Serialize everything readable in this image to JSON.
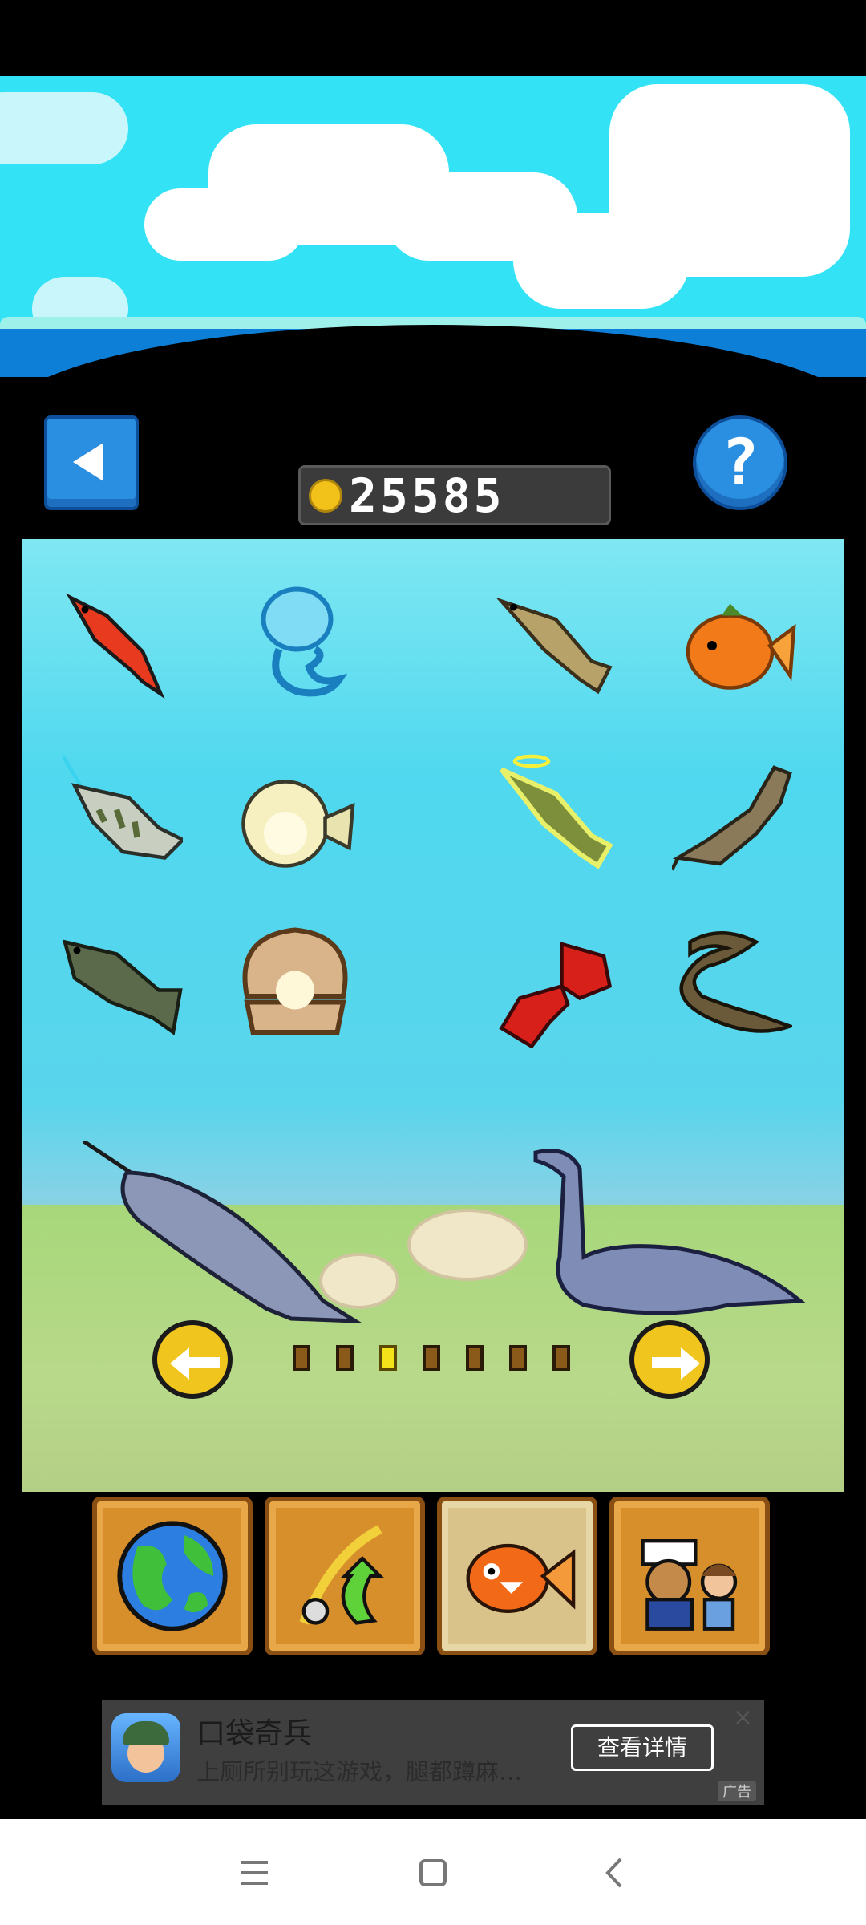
{
  "header": {
    "coins": "25585",
    "back_icon": "back-arrow-icon",
    "help_label": "?"
  },
  "aquarium": {
    "fish": [
      {
        "name": "red-goldfish"
      },
      {
        "name": "blue-jellyfish"
      },
      {
        "name": "brown-trout"
      },
      {
        "name": "orange-fish"
      },
      {
        "name": "archerfish"
      },
      {
        "name": "pufferfish"
      },
      {
        "name": "golden-pike"
      },
      {
        "name": "catfish"
      },
      {
        "name": "carp"
      },
      {
        "name": "pearl-clam"
      },
      {
        "name": "red-lobster"
      },
      {
        "name": "eel"
      }
    ],
    "large_creatures": [
      {
        "name": "narwhal"
      },
      {
        "name": "plesiosaur"
      }
    ],
    "pager": {
      "total_pages": 7,
      "current_page": 3
    }
  },
  "bottom_menu": [
    {
      "name": "world-map",
      "icon": "globe-icon",
      "active": false
    },
    {
      "name": "fishing-rod-upgrade",
      "icon": "fishing-rod-upgrade-icon",
      "active": false
    },
    {
      "name": "aquarium",
      "icon": "fish-icon",
      "active": true
    },
    {
      "name": "crew",
      "icon": "characters-icon",
      "active": false
    }
  ],
  "ad": {
    "title": "口袋奇兵",
    "description": "上厕所别玩这游戏，腿都蹲麻…",
    "cta": "查看详情",
    "close": "×",
    "tag": "广告"
  },
  "colors": {
    "sky": "#33e3f5",
    "water": "#4fd8ef",
    "button_blue": "#2a8fe0",
    "pager_yellow": "#f0c61e",
    "menu_orange": "#d78f2c"
  }
}
